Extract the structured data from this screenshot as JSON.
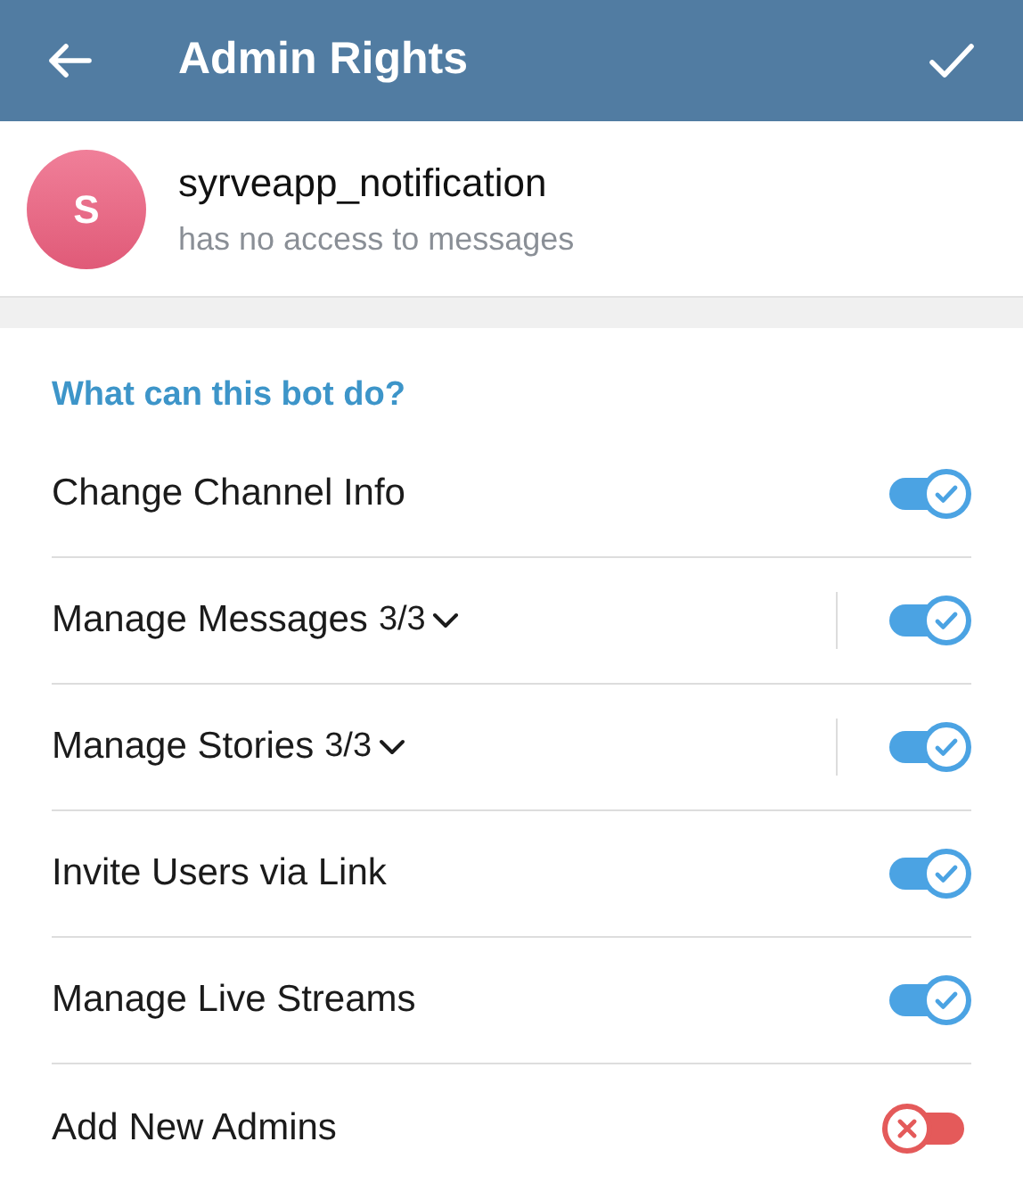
{
  "header": {
    "title": "Admin Rights"
  },
  "bot": {
    "initial": "S",
    "name": "syrveapp_notification",
    "status": "has no access to messages"
  },
  "section": {
    "title": "What can this bot do?"
  },
  "permissions": [
    {
      "kind": "toggle",
      "label": "Change Channel Info",
      "on": true
    },
    {
      "kind": "expandable",
      "label": "Manage Messages",
      "count": "3/3",
      "on": true
    },
    {
      "kind": "expandable",
      "label": "Manage Stories",
      "count": "3/3",
      "on": true
    },
    {
      "kind": "toggle",
      "label": "Invite Users via Link",
      "on": true
    },
    {
      "kind": "toggle",
      "label": "Manage Live Streams",
      "on": true
    },
    {
      "kind": "toggle",
      "label": "Add New Admins",
      "on": false
    }
  ]
}
